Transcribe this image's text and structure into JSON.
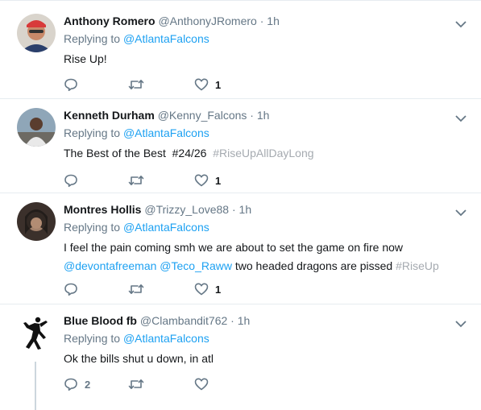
{
  "tweets": [
    {
      "name": "Anthony Romero",
      "handle": "@AnthonyJRomero",
      "time": "1h",
      "replying_prefix": "Replying to ",
      "replying_to": "@AtlantaFalcons",
      "text_parts": [
        {
          "t": "Rise Up!",
          "k": "plain"
        }
      ],
      "reply_count": "",
      "retweet_count": "",
      "like_count": "1"
    },
    {
      "name": "Kenneth Durham",
      "handle": "@Kenny_Falcons",
      "time": "1h",
      "replying_prefix": "Replying to ",
      "replying_to": "@AtlantaFalcons",
      "text_parts": [
        {
          "t": "The Best of the Best  #24/26  ",
          "k": "plain"
        },
        {
          "t": "#RiseUpAllDayLong",
          "k": "hash"
        }
      ],
      "reply_count": "",
      "retweet_count": "",
      "like_count": "1"
    },
    {
      "name": "Montres Hollis",
      "handle": "@Trizzy_Love88",
      "time": "1h",
      "replying_prefix": "Replying to ",
      "replying_to": "@AtlantaFalcons",
      "text_line1": "I feel the pain coming smh we are about to set the game on fire now",
      "mention1": "@devontafreeman",
      "mention2": "@Teco_Raww",
      "text_mid": " two headed dragons are pissed ",
      "hashtag": "#RiseUp",
      "reply_count": "",
      "retweet_count": "",
      "like_count": "1"
    },
    {
      "name": "Blue Blood fb",
      "handle": "@Clambandit762",
      "time": "1h",
      "replying_prefix": "Replying to ",
      "replying_to": "@AtlantaFalcons",
      "text_parts": [
        {
          "t": "Ok the bills shut u down, in atl",
          "k": "plain"
        }
      ],
      "reply_count": "2",
      "retweet_count": "",
      "like_count": ""
    }
  ],
  "separator": " · ",
  "icons": {
    "reply": "reply-icon",
    "retweet": "retweet-icon",
    "like": "heart-icon",
    "more": "chevron-down-icon",
    "brand_logo": "jumpman-logo"
  },
  "colors": {
    "link": "#1da1f2",
    "muted": "#657786",
    "icon": "#657786",
    "divider": "#e6ecf0"
  }
}
